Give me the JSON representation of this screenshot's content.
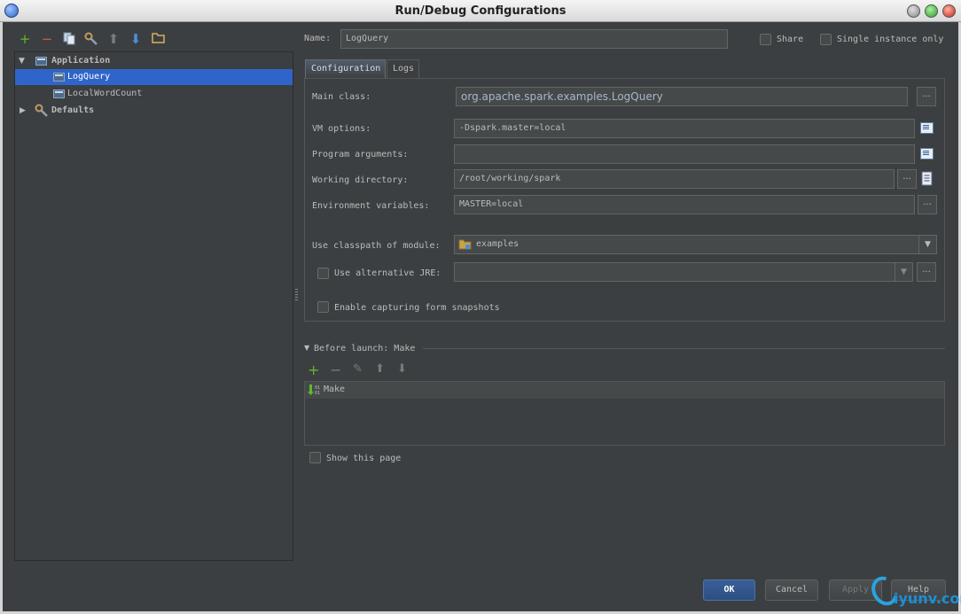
{
  "window": {
    "title": "Run/Debug Configurations"
  },
  "left_toolbar": {
    "icons": [
      "add-icon",
      "remove-icon",
      "copy-icon",
      "edit-defaults-icon",
      "move-up-icon",
      "move-down-icon",
      "folder-icon"
    ],
    "add_glyph": "+",
    "remove_glyph": "−",
    "up_glyph": "⬆",
    "down_glyph": "⬇"
  },
  "tree": {
    "group_application": "Application",
    "item_logquery": "LogQuery",
    "item_localwordcount": "LocalWordCount",
    "group_defaults": "Defaults"
  },
  "header": {
    "name_label": "Name:",
    "name_value": "LogQuery",
    "share_label": "Share",
    "single_instance_label": "Single instance only"
  },
  "tabs": {
    "configuration": "Configuration",
    "logs": "Logs"
  },
  "form": {
    "main_class_label": "Main class:",
    "main_class_value": "org.apache.spark.examples.LogQuery",
    "vm_options_label": "VM options:",
    "vm_options_value": "-Dspark.master=local",
    "program_args_label": "Program arguments:",
    "program_args_value": "",
    "working_dir_label": "Working directory:",
    "working_dir_value": "/root/working/spark",
    "env_vars_label": "Environment variables:",
    "env_vars_value": "MASTER=local",
    "classpath_label": "Use classpath of module:",
    "classpath_value": "examples",
    "alt_jre_label": "Use alternative JRE:",
    "alt_jre_value": "",
    "snapshots_label": "Enable capturing form snapshots",
    "ellipsis": "...",
    "dropdown_arrow": "▼"
  },
  "before_launch": {
    "title": "Before launch: Make",
    "item": "Make",
    "add_glyph": "+",
    "remove_glyph": "−",
    "edit_glyph": "✎",
    "up_glyph": "⬆",
    "down_glyph": "⬇"
  },
  "show_page_label": "Show this page",
  "buttons": {
    "ok": "OK",
    "cancel": "Cancel",
    "apply": "Apply",
    "help": "Help"
  },
  "watermark": {
    "text": "iyunv.com"
  },
  "colors": {
    "selection": "#2f65ca",
    "background": "#3c3f41",
    "accent_green": "#5fb832",
    "accent_red": "#d9534f"
  }
}
